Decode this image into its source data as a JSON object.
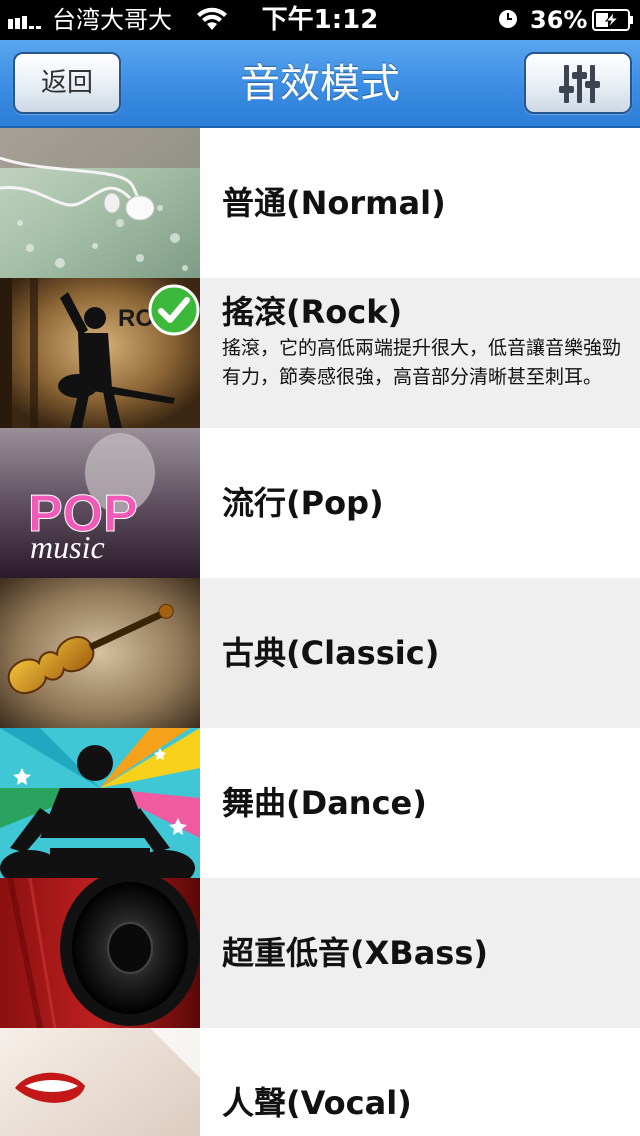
{
  "status_bar": {
    "carrier": "台湾大哥大",
    "time": "下午1:12",
    "battery": "36%"
  },
  "nav": {
    "back_label": "返回",
    "title": "音效模式",
    "equalizer_icon": "equalizer-sliders-icon"
  },
  "modes": [
    {
      "title": "普通(Normal)",
      "description": "",
      "selected": false,
      "thumb": "earphones"
    },
    {
      "title": "搖滾(Rock)",
      "description": "搖滾，它的高低兩端提升很大，低音讓音樂強勁有力，節奏感很強，高音部分清晰甚至刺耳。",
      "selected": true,
      "thumb": "rock",
      "thumb_text": "RO"
    },
    {
      "title": "流行(Pop)",
      "description": "",
      "selected": false,
      "thumb": "pop",
      "thumb_text": [
        "POP",
        "music"
      ]
    },
    {
      "title": "古典(Classic)",
      "description": "",
      "selected": false,
      "thumb": "violin"
    },
    {
      "title": "舞曲(Dance)",
      "description": "",
      "selected": false,
      "thumb": "dj"
    },
    {
      "title": "超重低音(XBass)",
      "description": "",
      "selected": false,
      "thumb": "speaker"
    },
    {
      "title": "人聲(Vocal)",
      "description": "",
      "selected": false,
      "thumb": "singer"
    }
  ],
  "colors": {
    "nav_blue": "#3d8ee4",
    "row_alt": "#efefef",
    "check_green": "#3cb83a"
  }
}
